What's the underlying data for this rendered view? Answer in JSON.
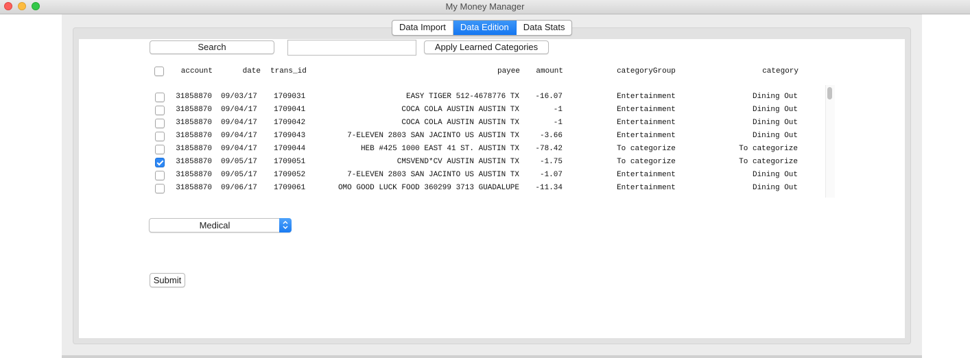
{
  "window": {
    "title": "My Money Manager"
  },
  "tabs": [
    {
      "label": "Data Import",
      "active": false
    },
    {
      "label": "Data Edition",
      "active": true
    },
    {
      "label": "Data Stats",
      "active": false
    }
  ],
  "toolbar": {
    "search_label": "Search",
    "search_value": "",
    "apply_label": "Apply Learned Categories"
  },
  "table": {
    "columns": [
      "account",
      "date",
      "trans_id",
      "payee",
      "amount",
      "categoryGroup",
      "category"
    ],
    "rows": [
      {
        "checked": false,
        "account": "31858870",
        "date": "09/03/17",
        "trans_id": "1709031",
        "payee": "EASY TIGER 512-4678776 TX",
        "amount": "-16.07",
        "categoryGroup": "Entertainment",
        "category": "Dining Out"
      },
      {
        "checked": false,
        "account": "31858870",
        "date": "09/04/17",
        "trans_id": "1709041",
        "payee": "COCA COLA AUSTIN AUSTIN TX",
        "amount": "-1",
        "categoryGroup": "Entertainment",
        "category": "Dining Out"
      },
      {
        "checked": false,
        "account": "31858870",
        "date": "09/04/17",
        "trans_id": "1709042",
        "payee": "COCA COLA AUSTIN AUSTIN TX",
        "amount": "-1",
        "categoryGroup": "Entertainment",
        "category": "Dining Out"
      },
      {
        "checked": false,
        "account": "31858870",
        "date": "09/04/17",
        "trans_id": "1709043",
        "payee": "7-ELEVEN 2803 SAN JACINTO US AUSTIN TX",
        "amount": "-3.66",
        "categoryGroup": "Entertainment",
        "category": "Dining Out"
      },
      {
        "checked": false,
        "account": "31858870",
        "date": "09/04/17",
        "trans_id": "1709044",
        "payee": "HEB #425 1000 EAST 41 ST. AUSTIN TX",
        "amount": "-78.42",
        "categoryGroup": "To categorize",
        "category": "To categorize"
      },
      {
        "checked": true,
        "account": "31858870",
        "date": "09/05/17",
        "trans_id": "1709051",
        "payee": "CMSVEND*CV AUSTIN AUSTIN TX",
        "amount": "-1.75",
        "categoryGroup": "To categorize",
        "category": "To categorize"
      },
      {
        "checked": false,
        "account": "31858870",
        "date": "09/05/17",
        "trans_id": "1709052",
        "payee": "7-ELEVEN 2803 SAN JACINTO US AUSTIN TX",
        "amount": "-1.07",
        "categoryGroup": "Entertainment",
        "category": "Dining Out"
      },
      {
        "checked": false,
        "account": "31858870",
        "date": "09/06/17",
        "trans_id": "1709061",
        "payee": "OMO GOOD LUCK FOOD 360299 3713 GUADALUPE",
        "amount": "-11.34",
        "categoryGroup": "Entertainment",
        "category": "Dining Out"
      }
    ]
  },
  "category_select": {
    "value": "Medical"
  },
  "submit_label": "Submit",
  "colors": {
    "accent": "#1577f1",
    "checkbox_checked": "#2e88f5"
  },
  "icons": {
    "select_arrows": "updown-chevron-icon"
  }
}
